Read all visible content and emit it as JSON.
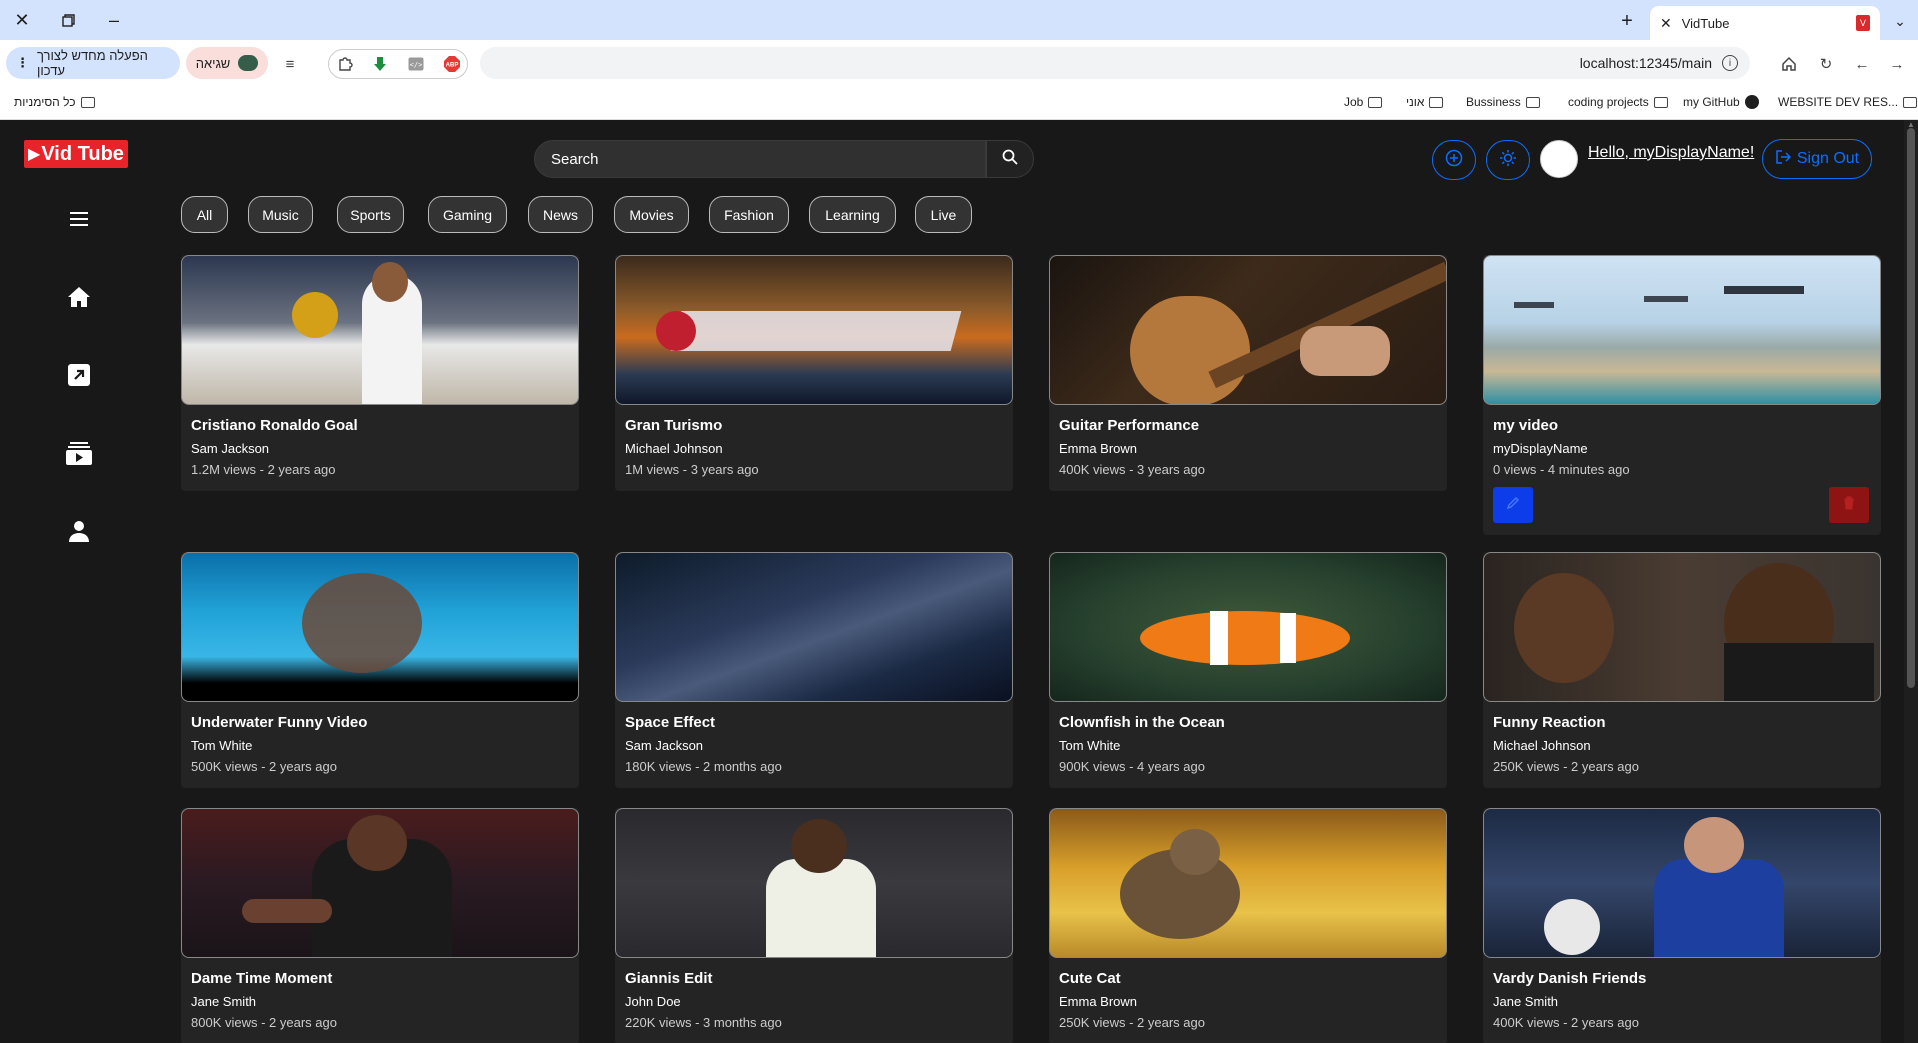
{
  "browser": {
    "tab_title": "VidTube",
    "favicon_text": "V",
    "url": "localhost:12345/main",
    "update_label": "הפעלה מחדש לצורך עדכון",
    "error_label": "שגיאה",
    "bookmarks": [
      "WEBSITE DEV RES...",
      "my GitHub",
      "coding projects",
      "Bussiness",
      "אוני",
      "Job",
      "כל הסימניות"
    ]
  },
  "app": {
    "logo_text": "Vid Tube",
    "search_placeholder": "Search",
    "greeting": "Hello, myDisplayName!",
    "sign_out_label": "Sign Out",
    "categories": [
      "All",
      "Music",
      "Sports",
      "Gaming",
      "News",
      "Movies",
      "Fashion",
      "Learning",
      "Live"
    ],
    "videos": [
      {
        "title": "Cristiano Ronaldo Goal",
        "author": "Sam Jackson",
        "meta": "1.2M views - 2 years ago"
      },
      {
        "title": "Gran Turismo",
        "author": "Michael Johnson",
        "meta": "1M views - 3 years ago"
      },
      {
        "title": "Guitar Performance",
        "author": "Emma Brown",
        "meta": "400K views - 3 years ago"
      },
      {
        "title": "my video",
        "author": "myDisplayName",
        "meta": "0 views - 4 minutes ago"
      },
      {
        "title": "Underwater Funny Video",
        "author": "Tom White",
        "meta": "500K views - 2 years ago"
      },
      {
        "title": "Space Effect",
        "author": "Sam Jackson",
        "meta": "180K views - 2 months ago"
      },
      {
        "title": "Clownfish in the Ocean",
        "author": "Tom White",
        "meta": "900K views - 4 years ago"
      },
      {
        "title": "Funny Reaction",
        "author": "Michael Johnson",
        "meta": "250K views - 2 years ago"
      },
      {
        "title": "Dame Time Moment",
        "author": "Jane Smith",
        "meta": "800K views - 2 years ago"
      },
      {
        "title": "Giannis Edit",
        "author": "John Doe",
        "meta": "220K views - 3 months ago"
      },
      {
        "title": "Cute Cat",
        "author": "Emma Brown",
        "meta": "250K views - 2 years ago"
      },
      {
        "title": "Vardy Danish Friends",
        "author": "Jane Smith",
        "meta": "400K views - 2 years ago"
      }
    ]
  },
  "colors": {
    "brand_red": "#e8232a",
    "accent_blue": "#0d6efd",
    "edit_blue": "#0d3de8",
    "delete_red": "#8e1414",
    "background": "#181818",
    "card": "#242424"
  }
}
